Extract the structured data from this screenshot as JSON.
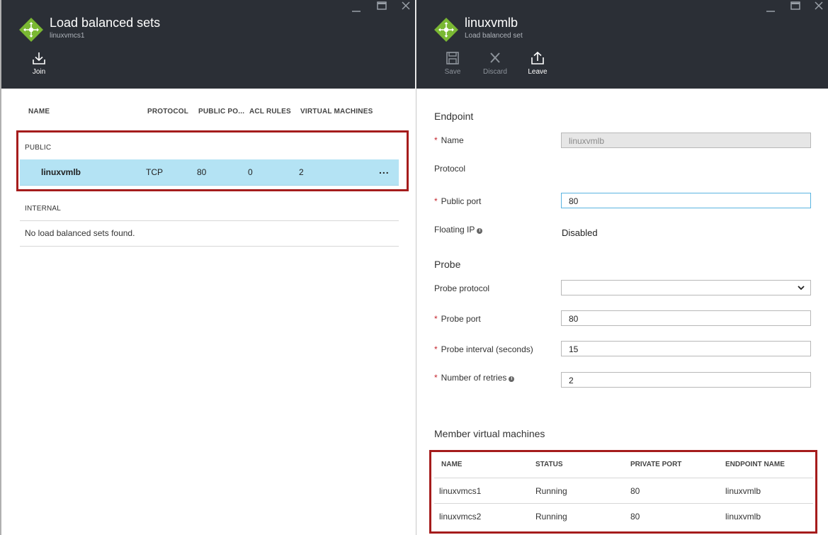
{
  "left_blade": {
    "title": "Load balanced sets",
    "subtitle": "linuxvmcs1",
    "commands": [
      {
        "label": "Join",
        "icon": "download-icon"
      }
    ],
    "columns": [
      "NAME",
      "PROTOCOL",
      "PUBLIC PO...",
      "ACL RULES",
      "VIRTUAL MACHINES"
    ],
    "groups": {
      "public_label": "PUBLIC",
      "public_row": {
        "name": "linuxvmlb",
        "protocol": "TCP",
        "public_port": "80",
        "acl_rules": "0",
        "virtual_machines": "2",
        "more": "..."
      },
      "internal_label": "INTERNAL",
      "internal_empty": "No load balanced sets found."
    }
  },
  "right_blade": {
    "title": "linuxvmlb",
    "subtitle": "Load balanced set",
    "commands": [
      {
        "label": "Save",
        "icon": "save-icon",
        "enabled": false
      },
      {
        "label": "Discard",
        "icon": "discard-icon",
        "enabled": false
      },
      {
        "label": "Leave",
        "icon": "leave-icon",
        "enabled": true
      }
    ],
    "form": {
      "endpoint_section": "Endpoint",
      "name_label": "Name",
      "name_value": "linuxvmlb",
      "protocol_label": "Protocol",
      "public_port_label": "Public port",
      "public_port_value": "80",
      "floating_ip_label": "Floating IP",
      "floating_ip_value": "Disabled",
      "probe_section": "Probe",
      "probe_protocol_label": "Probe protocol",
      "probe_protocol_value": "",
      "probe_port_label": "Probe port",
      "probe_port_value": "80",
      "probe_interval_label": "Probe interval (seconds)",
      "probe_interval_value": "15",
      "retries_label": "Number of retries",
      "retries_value": "2"
    },
    "members": {
      "section": "Member virtual machines",
      "columns": [
        "NAME",
        "STATUS",
        "PRIVATE PORT",
        "ENDPOINT NAME"
      ],
      "rows": [
        {
          "name": "linuxvmcs1",
          "status": "Running",
          "private_port": "80",
          "endpoint_name": "linuxvmlb"
        },
        {
          "name": "linuxvmcs2",
          "status": "Running",
          "private_port": "80",
          "endpoint_name": "linuxvmlb"
        }
      ]
    }
  },
  "colors": {
    "header_bg": "#2b2f36",
    "selected_row": "#b4e3f4",
    "highlight_border": "#a51c1c",
    "required": "#c4262e",
    "icon_green": "#7ab833"
  }
}
